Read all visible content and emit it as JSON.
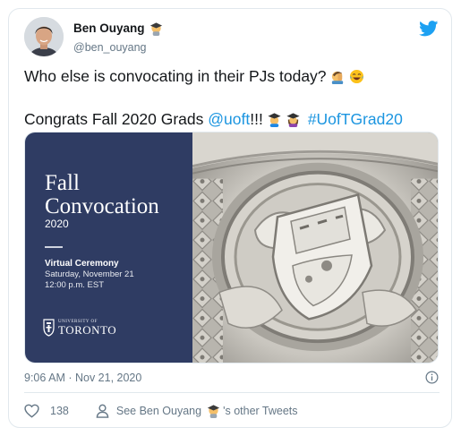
{
  "tweet": {
    "author": {
      "name": "Ben Ouyang",
      "handle": "@ben_ouyang",
      "name_emoji": "student-emoji"
    },
    "line1": {
      "text": "Who else is convocating in their PJs today?",
      "emojis": [
        "person-facepalming-emoji",
        "tears-of-joy-emoji"
      ]
    },
    "line2": {
      "prefix": "Congrats Fall 2020 Grads ",
      "mention": "@uoft",
      "suffix": "!!!",
      "emojis": [
        "man-student-emoji",
        "woman-student-emoji"
      ],
      "hashtag": "#UofTGrad20"
    },
    "media": {
      "title_line1": "Fall",
      "title_line2": "Convocation",
      "year": "2020",
      "event": "Virtual Ceremony",
      "date": "Saturday, November 21",
      "time": "12:00 p.m. EST",
      "logo_small": "UNIVERSITY OF",
      "logo_big": "TORONTO"
    },
    "timestamp": "9:06 AM · Nov 21, 2020",
    "likes": "138",
    "other_tweets_prefix": "See Ben Ouyang",
    "other_tweets_suffix": "'s other Tweets",
    "colors": {
      "link": "#1b95e0",
      "text": "#14171a",
      "muted": "#657786",
      "media_panel": "#2f3c63"
    }
  }
}
